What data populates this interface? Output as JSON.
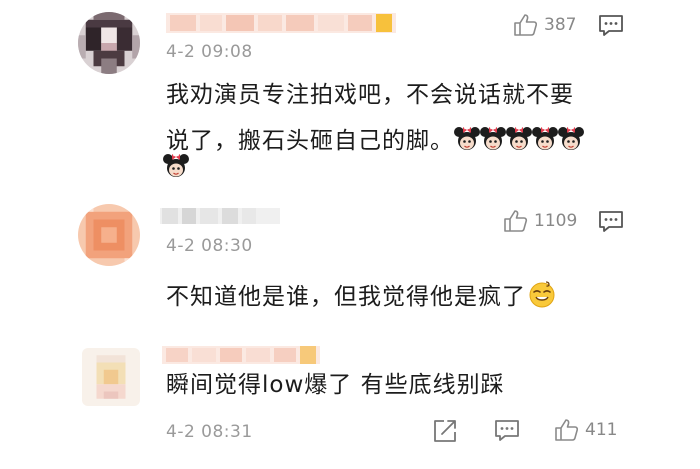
{
  "comments": [
    {
      "time": "4-2 09:08",
      "likes": "387",
      "text_line1": "我劝演员专注拍戏吧，不会说话就不要",
      "text_line2": "说了，搬石头砸自己的脚。",
      "emoji": "minnie-mouse-emoji",
      "emoji_count": 6
    },
    {
      "time": "4-2 08:30",
      "likes": "1109",
      "text": "不知道他是谁，但我觉得他是疯了",
      "emoji": "dizzy-smile-emoji"
    },
    {
      "time": "4-2 08:31",
      "likes": "411",
      "text": "瞬间觉得low爆了 有些底线别踩"
    }
  ],
  "icons": {
    "like": "thumbs-up-icon",
    "reply": "comment-icon",
    "share": "share-icon"
  },
  "colors": {
    "accent_yellow": "#f7c13c",
    "text_gray": "#9a9a9a",
    "name_blur": "#f3c9b8"
  }
}
